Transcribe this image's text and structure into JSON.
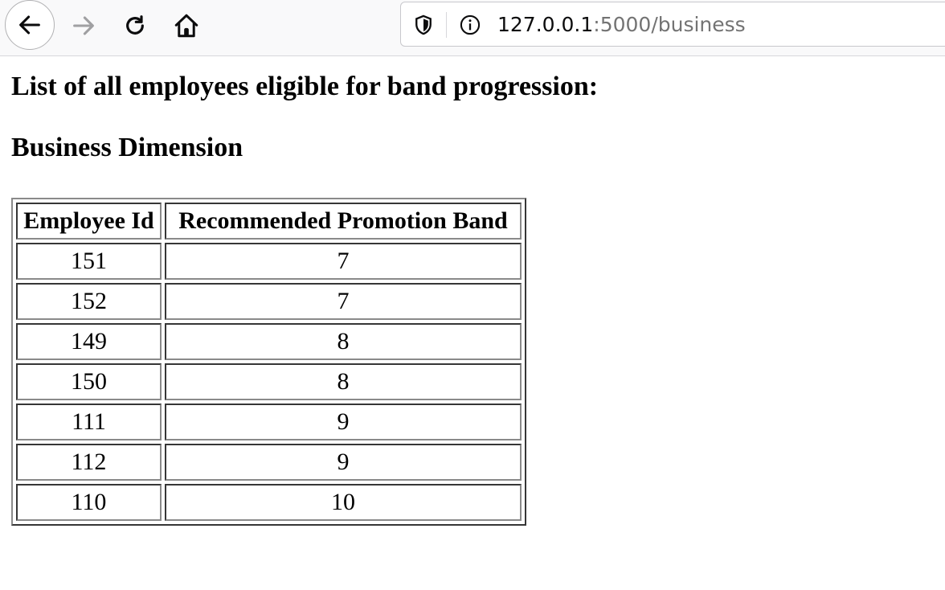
{
  "browser": {
    "url_host": "127.0.0.1",
    "url_path": ":5000/business",
    "icons": {
      "back": "arrow-left-icon",
      "forward": "arrow-right-icon",
      "reload": "reload-icon",
      "home": "home-icon",
      "tracking": "shield-icon",
      "site_info": "info-icon"
    }
  },
  "page": {
    "heading": "List of all employees eligible for band progression:",
    "subheading": "Business Dimension",
    "table": {
      "headers": [
        "Employee Id",
        "Recommended Promotion Band"
      ],
      "rows": [
        {
          "id": "151",
          "band": "7"
        },
        {
          "id": "152",
          "band": "7"
        },
        {
          "id": "149",
          "band": "8"
        },
        {
          "id": "150",
          "band": "8"
        },
        {
          "id": "111",
          "band": "9"
        },
        {
          "id": "112",
          "band": "9"
        },
        {
          "id": "110",
          "band": "10"
        }
      ]
    }
  }
}
